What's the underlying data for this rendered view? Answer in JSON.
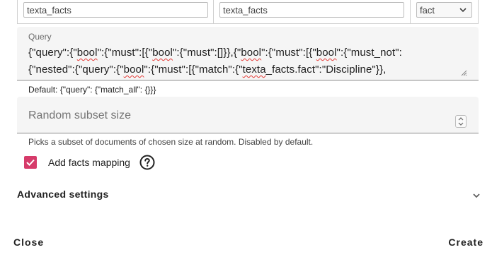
{
  "facts_row": {
    "field_1_value": "texta_facts",
    "field_2_value": "texta_facts",
    "select_value": "fact"
  },
  "query": {
    "label": "Query",
    "line_1": [
      {
        "text": "{\"query\":{\"",
        "spell": false
      },
      {
        "text": "bool",
        "spell": true
      },
      {
        "text": "\":{\"must\":[{\"",
        "spell": false
      },
      {
        "text": "bool",
        "spell": true
      },
      {
        "text": "\":{\"must\":[]}},{\"",
        "spell": false
      },
      {
        "text": "bool",
        "spell": true
      },
      {
        "text": "\":{\"must\":[{\"",
        "spell": false
      },
      {
        "text": "bool",
        "spell": true
      },
      {
        "text": "\":{\"must_not\":",
        "spell": false
      }
    ],
    "line_2": [
      {
        "text": "{\"nested\":{\"query\":{\"",
        "spell": false
      },
      {
        "text": "bool",
        "spell": true
      },
      {
        "text": "\":{\"must\":[{\"match\":{\"",
        "spell": false
      },
      {
        "text": "texta",
        "spell": true
      },
      {
        "text": "_facts.fact\":\"Discipline\"}},",
        "spell": false
      }
    ],
    "hint": "Default: {\"query\": {\"match_all\": {}}}"
  },
  "random_subset": {
    "placeholder": "Random subset size",
    "hint": "Picks a subset of documents of chosen size at random. Disabled by default."
  },
  "add_facts_mapping": {
    "label": "Add facts mapping",
    "checked": true,
    "accent_color": "#d63b6a"
  },
  "advanced": {
    "title": "Advanced settings"
  },
  "actions": {
    "close_label": "Close",
    "create_label": "Create"
  }
}
